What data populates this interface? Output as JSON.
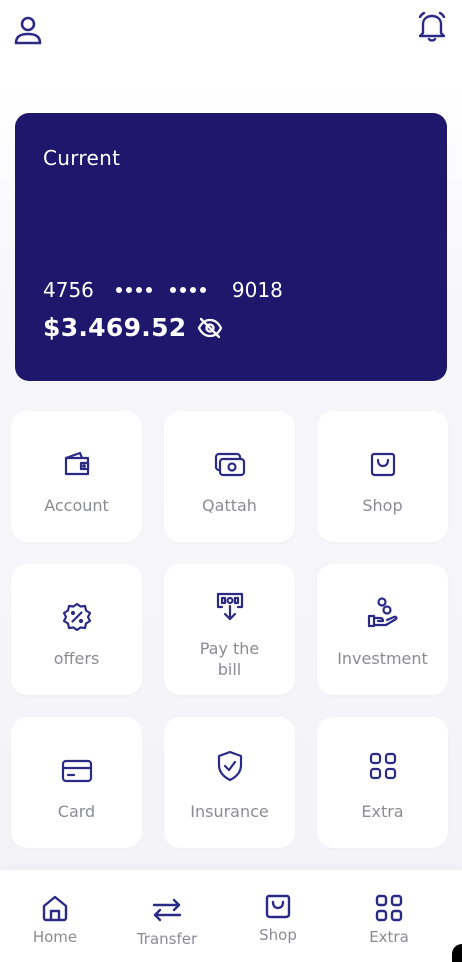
{
  "header": {
    "profile_icon": "user-icon",
    "notification_icon": "bell-icon"
  },
  "card": {
    "type": "Current",
    "number_first": "4756",
    "number_last": "9018",
    "balance": "$3.469.52",
    "visibility_icon": "eye-off-icon",
    "background_color": "#1e176c"
  },
  "services": [
    {
      "label": "Account",
      "icon": "wallet-icon"
    },
    {
      "label": "Qattah",
      "icon": "cash-icon"
    },
    {
      "label": "Shop",
      "icon": "shopping-bag-icon"
    },
    {
      "label": "offers",
      "icon": "discount-badge-icon"
    },
    {
      "label": "Pay the bill",
      "icon": "bill-icon"
    },
    {
      "label": "Investment",
      "icon": "investment-icon"
    },
    {
      "label": "Card",
      "icon": "credit-card-icon"
    },
    {
      "label": "Insurance",
      "icon": "shield-check-icon"
    },
    {
      "label": "Extra",
      "icon": "grid-icon"
    }
  ],
  "bottom_nav": [
    {
      "label": "Home",
      "icon": "home-icon"
    },
    {
      "label": "Transfer",
      "icon": "transfer-icon"
    },
    {
      "label": "Shop",
      "icon": "shopping-bag-icon"
    },
    {
      "label": "Extra",
      "icon": "grid-icon"
    }
  ],
  "colors": {
    "accent": "#2b2b86",
    "label": "#8b8b94"
  }
}
